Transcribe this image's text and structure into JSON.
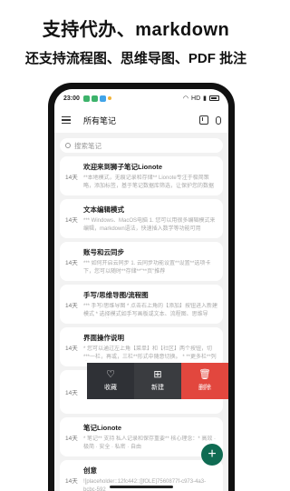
{
  "promo": {
    "title": "支持代办、markdown",
    "subtitle": "还支持流程图、思维导图、PDF 批注"
  },
  "statusbar": {
    "time": "23:00",
    "indicators": "HD"
  },
  "appbar": {
    "title": "所有笔记",
    "icons": [
      "menu-icon",
      "import-icon",
      "mic-icon"
    ]
  },
  "search": {
    "placeholder": "搜索笔记"
  },
  "notes": [
    {
      "date": "14天",
      "title": "欢迎来到狮子笔记Lionote",
      "desc": "**本地模式，无痕记录和存储** Lionote专注于极简策略，添加标签，基于笔记数据库筛选，让保护您的数据"
    },
    {
      "date": "14天",
      "title": "文本编辑模式",
      "desc": "*** Windows、MacOS电脑 1. 您可以用很多编辑模式来编辑，markdown语法，快速插入数学等功能可用"
    },
    {
      "date": "14天",
      "title": "账号和云同步",
      "desc": "*** 如何开启云同步 1. 云同步功能设置**设置**选项卡下，您可以随时**存储**\"**页\"推荐"
    },
    {
      "date": "14天",
      "title": "手写/思维导图/流程图",
      "desc": "*** 手写/思维导图 * 点击右上角的【添加】按钮进入新建模式 * 选择模式如手写画板或文本、流程图、思维导图、PDF等"
    },
    {
      "date": "14天",
      "title": "界面操作说明",
      "desc": "* 您可以通过左上角【菜单】和【社区】两个按钮，切***一栏，再或，三栏**形式中随意切换。 * **更多栏**列表"
    },
    {
      "date": "14天",
      "title": "",
      "desc": ""
    },
    {
      "date": "14天",
      "title": "笔记Lionote",
      "desc": "* 笔记** 支持 私人记录和保存重要** 核心理念：* 高效 · 极简 · 安全 · 私密 · 自由"
    },
    {
      "date": "14天",
      "title": "创意",
      "desc": "![placeholder::12fc442::[]fOLE]7560877f-c973-4a3-bcbc-592"
    }
  ],
  "actions": {
    "favorite": "收藏",
    "new": "新建",
    "delete": "删除"
  },
  "fab": {
    "label": "+"
  },
  "colors": {
    "accent": "#0f6b52",
    "delete": "#e2473e",
    "actionbar": "#2f3136"
  }
}
